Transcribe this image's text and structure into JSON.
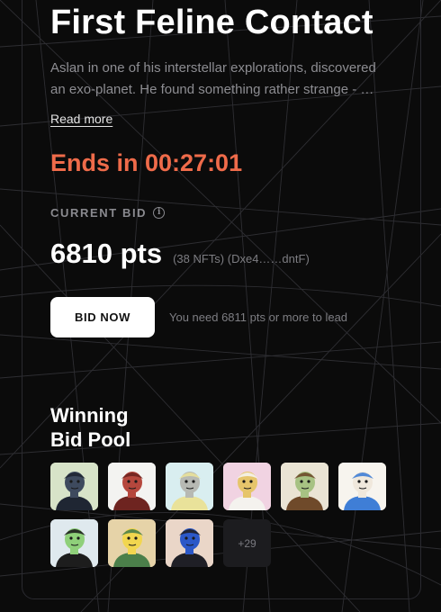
{
  "auction": {
    "title": "First Feline Contact",
    "description_lines": [
      "Aslan in one of his interstellar explorations, discovered",
      "an exo-planet. He found something rather strange - …"
    ],
    "read_more_label": "Read more",
    "ends_text": "Ends in 00:27:01",
    "current_bid_label": "CURRENT BID",
    "current_bid_value": "6810 pts",
    "current_bid_meta": "(38 NFTs) (Dxe4……dntF)",
    "bid_button_label": "BID NOW",
    "bid_hint": "You need 6811 pts or more to lead"
  },
  "pool": {
    "title_lines": [
      "Winning",
      "Bid Pool"
    ],
    "more_count": "+29",
    "avatars": [
      {
        "name": "hooded-skull-avatar",
        "bg": "#d7e3c8",
        "skin": "#3e4a5e",
        "accent": "#1f2633"
      },
      {
        "name": "red-hair-avatar",
        "bg": "#f3f3f1",
        "skin": "#b5473d",
        "accent": "#6e2420"
      },
      {
        "name": "gray-alien-avatar",
        "bg": "#d9eef0",
        "skin": "#b7b9b3",
        "accent": "#e9e29a"
      },
      {
        "name": "pink-golden-avatar",
        "bg": "#f1d3e2",
        "skin": "#e6c56b",
        "accent": "#f4f2ee"
      },
      {
        "name": "green-zombie-avatar",
        "bg": "#eae4d4",
        "skin": "#a7c283",
        "accent": "#6f4a2a"
      },
      {
        "name": "cap-bubblegum-avatar",
        "bg": "#f7f4ee",
        "skin": "#f0e8dc",
        "accent": "#3f7ed6"
      },
      {
        "name": "green-spiky-avatar",
        "bg": "#dfe9ee",
        "skin": "#8fd07a",
        "accent": "#1d1d1d"
      },
      {
        "name": "yellow-dino-avatar",
        "bg": "#e6d3a8",
        "skin": "#f2d64f",
        "accent": "#4b7f4a"
      },
      {
        "name": "blue-helmet-avatar",
        "bg": "#ead6c8",
        "skin": "#2c58c8",
        "accent": "#1f1f26"
      }
    ]
  },
  "colors": {
    "background": "#0b0b0b",
    "accent_orange": "#ef6b4a",
    "muted_text": "#8d8d92",
    "button_bg": "#ffffff"
  }
}
